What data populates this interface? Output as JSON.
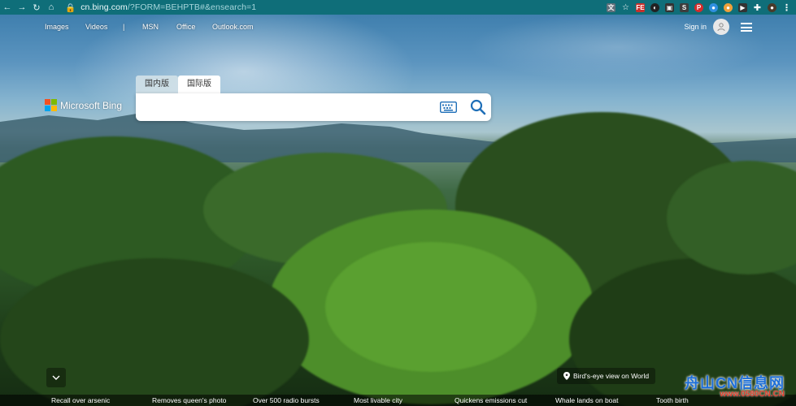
{
  "browser": {
    "url_main": "cn.bing.com",
    "url_rest": "/?FORM=BEHPTB#&ensearch=1"
  },
  "topnav": {
    "images": "Images",
    "videos": "Videos",
    "divider": "|",
    "msn": "MSN",
    "office": "Office",
    "outlook": "Outlook.com"
  },
  "account": {
    "signin": "Sign in"
  },
  "logo": {
    "brand": "Microsoft Bing"
  },
  "tabs": {
    "domestic": "国内版",
    "international": "国际版"
  },
  "search": {
    "placeholder": "",
    "value": ""
  },
  "image_info": {
    "location": "Bird's-eye view on World"
  },
  "news": [
    "Recall over arsenic",
    "Removes queen's photo",
    "Over 500 radio bursts",
    "Most livable city",
    "Quickens emissions cut",
    "Whale lands on boat",
    "Tooth birth"
  ],
  "watermark": {
    "title": "舟山CN信息网",
    "url": "www.0580CN.CN"
  },
  "colors": {
    "browser_bar": "#0f6e79",
    "watermark_blue": "#1e6fd8",
    "watermark_red": "#e0402e"
  }
}
